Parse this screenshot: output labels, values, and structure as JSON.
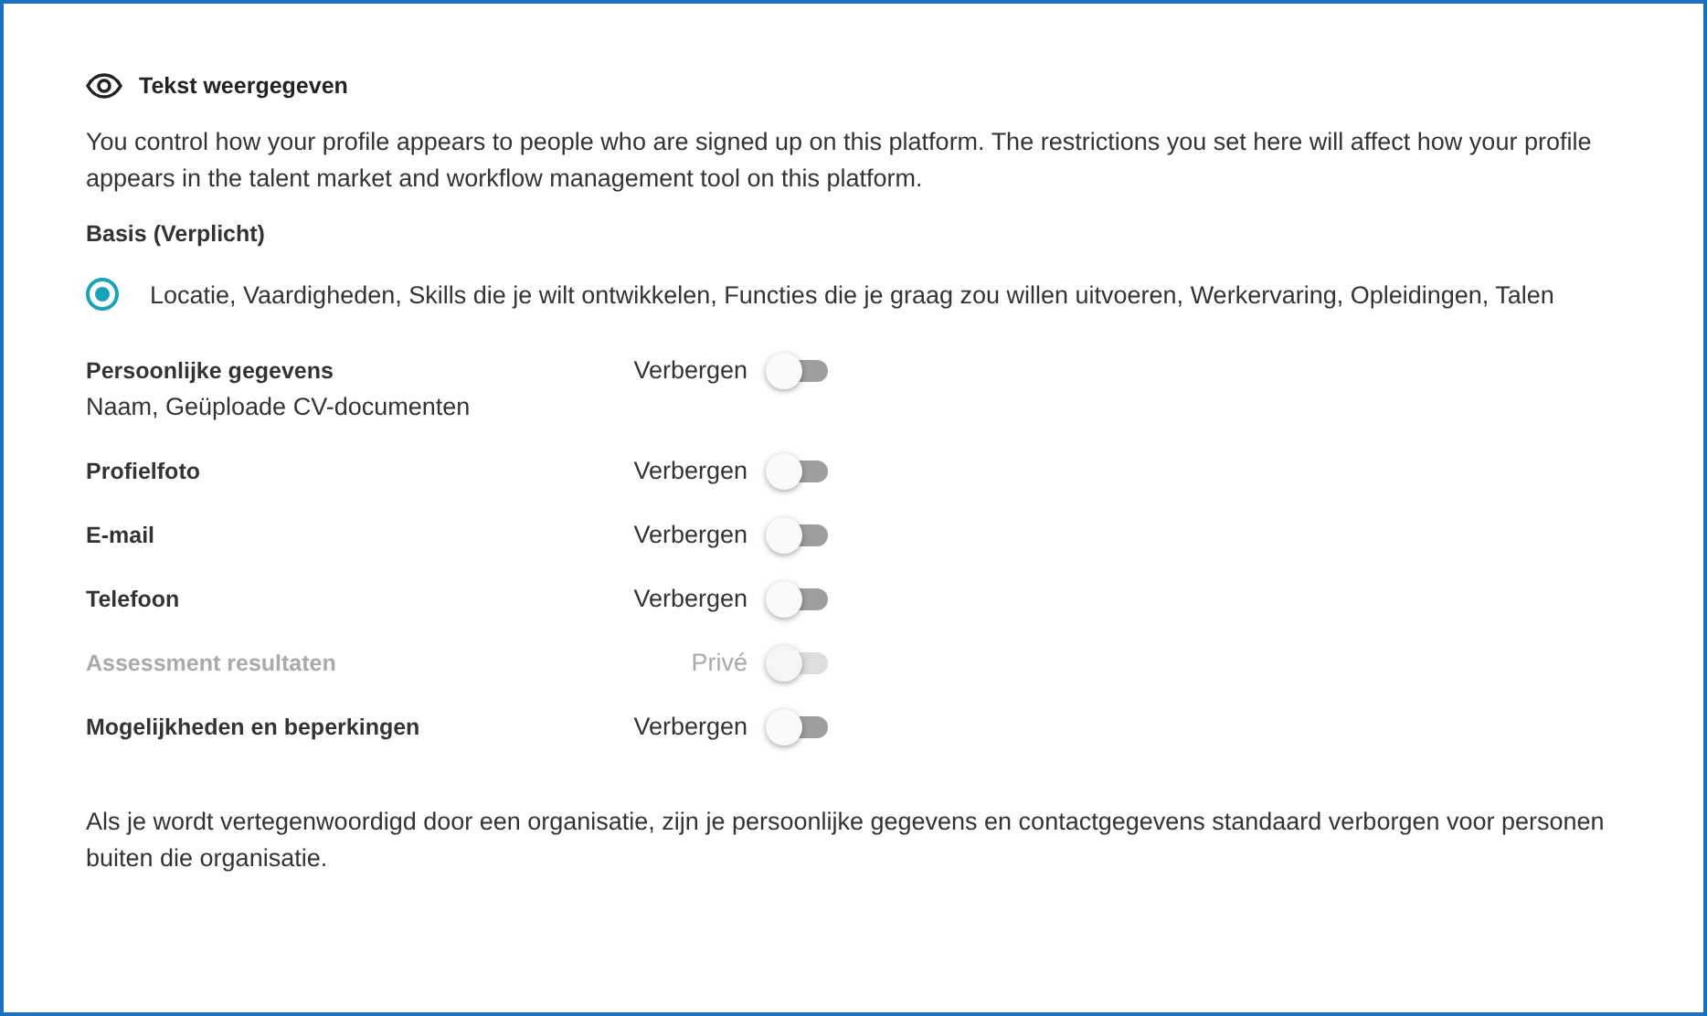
{
  "header": {
    "title": "Tekst weergegeven"
  },
  "intro": "You control how your profile appears to people who are signed up on this platform. The restrictions you set here will affect how your profile appears in the talent market and workflow management tool on this platform.",
  "basis": {
    "title": "Basis (Verplicht)",
    "option": {
      "label": "Locatie, Vaardigheden, Skills die je wilt ontwikkelen, Functies die je graag zou willen uitvoeren, Werkervaring, Opleidingen, Talen",
      "selected": true
    }
  },
  "settings": [
    {
      "name": "Persoonlijke gegevens",
      "detail": "Naam, Geüploade CV-documenten",
      "state_label": "Verbergen",
      "on": false,
      "disabled": false
    },
    {
      "name": "Profielfoto",
      "state_label": "Verbergen",
      "on": false,
      "disabled": false
    },
    {
      "name": "E-mail",
      "state_label": "Verbergen",
      "on": false,
      "disabled": false
    },
    {
      "name": "Telefoon",
      "state_label": "Verbergen",
      "on": false,
      "disabled": false
    },
    {
      "name": "Assessment resultaten",
      "state_label": "Privé",
      "on": false,
      "disabled": true
    },
    {
      "name": "Mogelijkheden en beperkingen",
      "state_label": "Verbergen",
      "on": false,
      "disabled": false
    }
  ],
  "footnote": "Als je wordt vertegenwoordigd door een organisatie, zijn je persoonlijke gegevens en contactgegevens standaard verborgen voor personen buiten die organisatie."
}
